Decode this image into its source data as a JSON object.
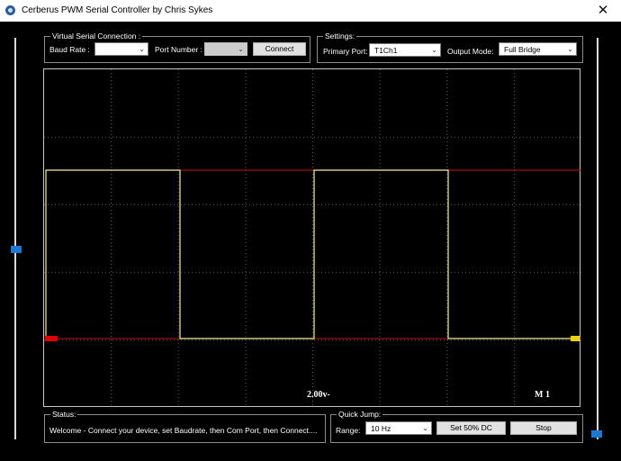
{
  "window": {
    "title": "Cerberus PWM Serial Controller by Chris Sykes",
    "close_glyph": "✕"
  },
  "serial": {
    "group_title": "Virtual Serial Connection :",
    "baud_label": "Baud Rate :",
    "baud_value": "",
    "port_label": "Port Number :",
    "port_value": "",
    "connect_label": "Connect"
  },
  "settings": {
    "group_title": "Settings:",
    "primary_label": "Primary Port:",
    "primary_value": "T1Ch1",
    "output_label": "Output Mode:",
    "output_value": "Full Bridge"
  },
  "scope": {
    "voltage_label": "2.00v-",
    "channel_label": "M 1",
    "left_marker_color": "#e00000",
    "right_marker_color": "#f0d000",
    "trace_color": "#f6f0a0",
    "reference_color": "#e00000"
  },
  "status": {
    "group_title": "Status:",
    "message": "Welcome - Connect your device, set Baudrate, then Com Port, then Connect...."
  },
  "quick_jump": {
    "group_title": "Quick Jump:",
    "range_label": "Range:",
    "range_value": "10 Hz",
    "set_dc_label": "Set 50% DC",
    "stop_label": "Stop"
  },
  "sliders": {
    "left_level": 0.47,
    "right_level": 0.0,
    "thumb_color": "#1d78d4"
  }
}
